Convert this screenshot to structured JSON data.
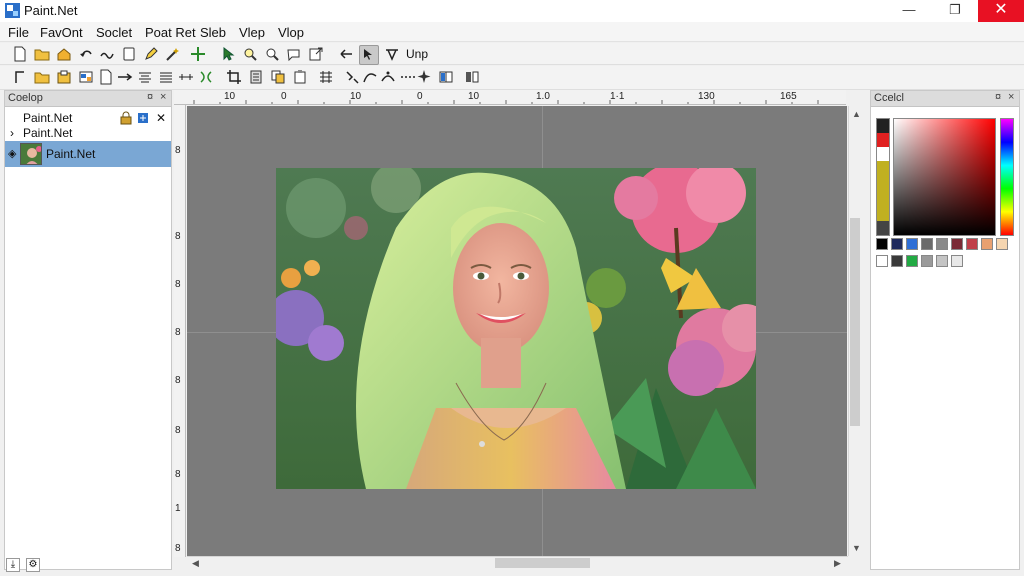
{
  "window": {
    "title": "Paint.Net",
    "close_glyph": "✕",
    "maximize_glyph": "❐",
    "minimize_glyph": "—"
  },
  "menu": [
    "File",
    "FavOnt",
    "Soclet",
    "Poat Ret",
    "Sleb",
    "Vlep",
    "Vlop"
  ],
  "toolbar1": {
    "text_button_label": "Unp"
  },
  "layers_panel": {
    "title": "Coelop",
    "controls": [
      "¤",
      "×"
    ],
    "tree": [
      {
        "arrow": "",
        "label": "Paint.Net"
      },
      {
        "arrow": "›",
        "label": "Paint.Net"
      }
    ],
    "selected_layer": {
      "label": "Paint.Net"
    }
  },
  "ruler_top": [
    "10",
    "0",
    "10",
    "0",
    "10",
    "1.0",
    "1·1",
    "130",
    "165"
  ],
  "ruler_left": [
    "8",
    "8",
    "8",
    "8",
    "8",
    "8",
    "8",
    "1",
    "8"
  ],
  "colors_panel": {
    "title": "Ccelcl",
    "controls": [
      "¤",
      "×"
    ],
    "palette_row1": [
      "#000000",
      "#1f2a5c",
      "#2f6fd6",
      "#6b6b6b",
      "#8a8a8a",
      "#7a2a35",
      "#c0404a",
      "#e8a070",
      "#f5d5b0"
    ],
    "palette_row2": [
      "#ffffff",
      "#3a3a3a",
      "#22aa44",
      "#9a9a9a",
      "#c4c4c4",
      "#e8e8e8"
    ]
  },
  "colors": {
    "selection": "#7aa7d4",
    "workspace": "#7b7b7b",
    "close_button": "#e81123"
  }
}
